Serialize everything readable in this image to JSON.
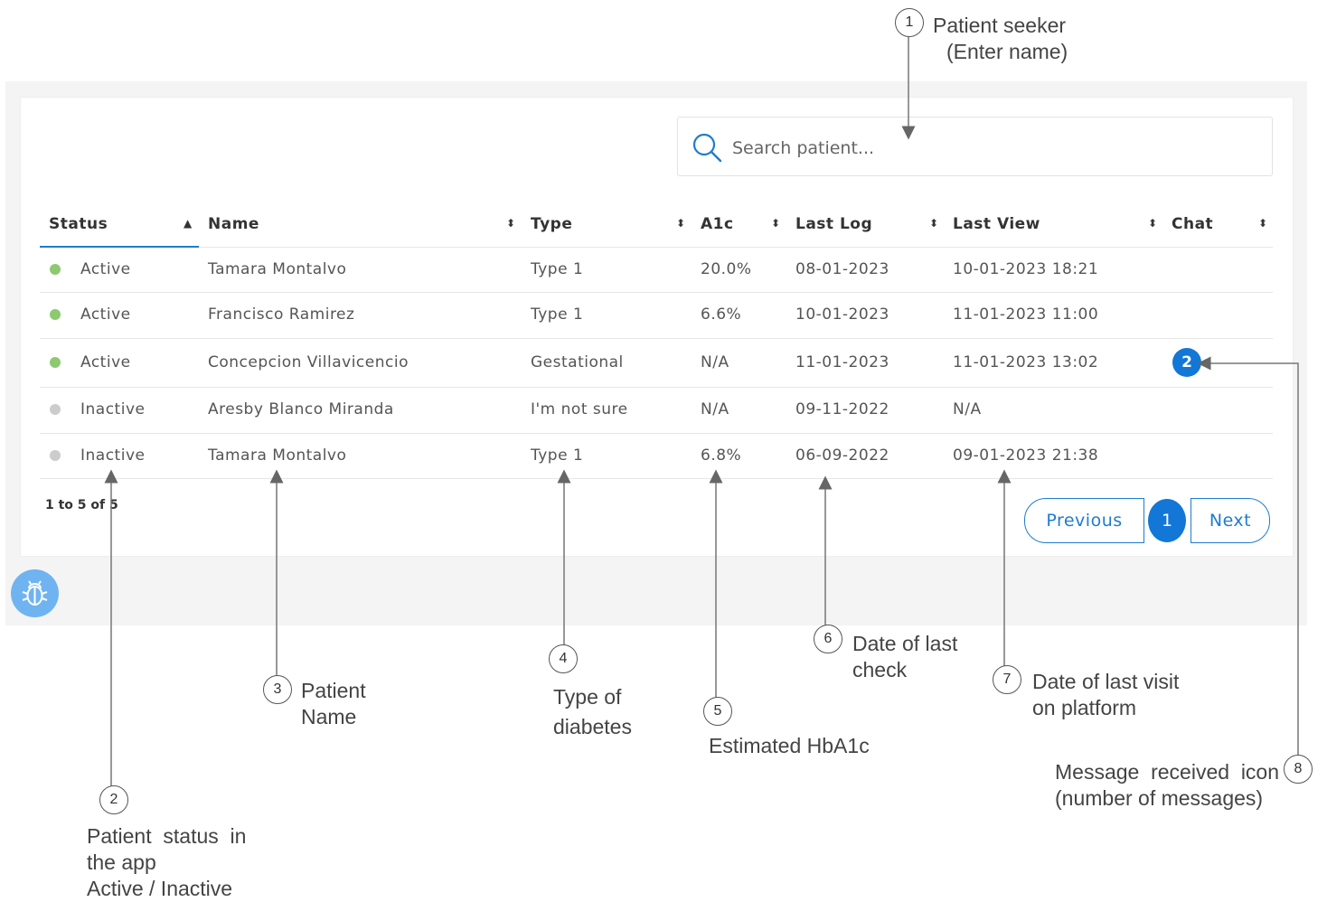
{
  "search": {
    "placeholder": "Search patient..."
  },
  "table": {
    "headers": [
      "Status",
      "Name",
      "Type",
      "A1c",
      "Last Log",
      "Last View",
      "Chat"
    ],
    "sort_asc_glyph": "▲",
    "sort_both_glyph": "⬍",
    "rows": [
      {
        "status": "Active",
        "status_color": "#8cc970",
        "name": "Tamara Montalvo",
        "type": "Type 1",
        "a1c": "20.0%",
        "last_log": "08-01-2023",
        "last_view": "10-01-2023 18:21",
        "chat": ""
      },
      {
        "status": "Active",
        "status_color": "#8cc970",
        "name": "Francisco Ramirez",
        "type": "Type 1",
        "a1c": "6.6%",
        "last_log": "10-01-2023",
        "last_view": "11-01-2023 11:00",
        "chat": ""
      },
      {
        "status": "Active",
        "status_color": "#8cc970",
        "name": "Concepcion Villavicencio",
        "type": "Gestational",
        "a1c": "N/A",
        "last_log": "11-01-2023",
        "last_view": "11-01-2023 13:02",
        "chat": "2"
      },
      {
        "status": "Inactive",
        "status_color": "#cccccc",
        "name": "Aresby Blanco Miranda",
        "type": "I'm not sure",
        "a1c": "N/A",
        "last_log": "09-11-2022",
        "last_view": "N/A",
        "chat": ""
      },
      {
        "status": "Inactive",
        "status_color": "#cccccc",
        "name": "Tamara Montalvo",
        "type": "Type 1",
        "a1c": "6.8%",
        "last_log": "06-09-2022",
        "last_view": "09-01-2023 21:38",
        "chat": ""
      }
    ]
  },
  "pagination": {
    "info": "1 to 5 of 5",
    "previous": "Previous",
    "current_page": "1",
    "next": "Next"
  },
  "icons": {
    "search": "search-icon",
    "bug": "bug-icon"
  },
  "colors": {
    "accent": "#1277d6",
    "active": "#8cc970",
    "inactive": "#cccccc",
    "bug_button": "#6fb4f0"
  },
  "annotations": [
    {
      "number": "1",
      "lines": [
        "Patient seeker",
        "  (Enter name)"
      ]
    },
    {
      "number": "2",
      "lines": [
        "Patient  status  in",
        "the app",
        "Active / Inactive"
      ]
    },
    {
      "number": "3",
      "lines": [
        "Patient",
        "Name"
      ]
    },
    {
      "number": "4",
      "lines": [
        "Type of",
        "diabetes"
      ]
    },
    {
      "number": "5",
      "lines": [
        "Estimated HbA1c"
      ]
    },
    {
      "number": "6",
      "lines": [
        "Date of last",
        "check"
      ]
    },
    {
      "number": "7",
      "lines": [
        "Date of last visit",
        "on platform"
      ]
    },
    {
      "number": "8",
      "lines": [
        "Message  received  icon",
        "(number of messages)"
      ]
    }
  ]
}
